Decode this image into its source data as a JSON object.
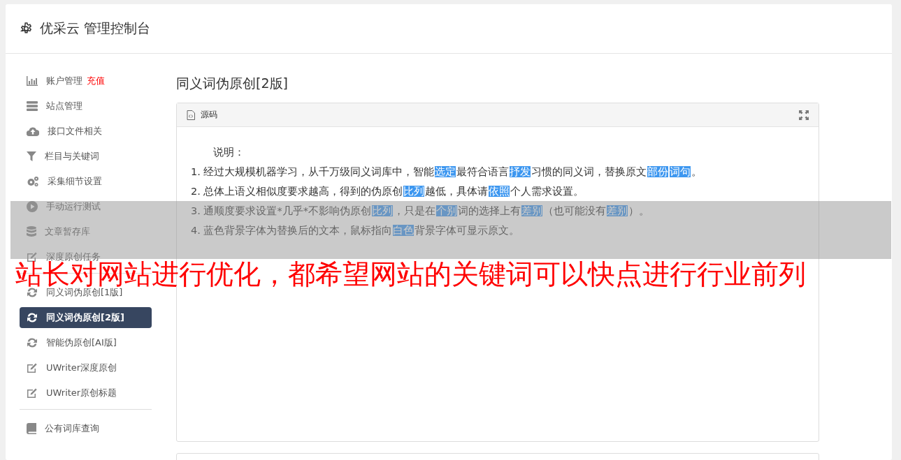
{
  "header": {
    "title": "优采云 管理控制台"
  },
  "sidebar": {
    "groups": [
      [
        {
          "label": "账户管理",
          "badge": "充值",
          "selected": false
        },
        {
          "label": "站点管理",
          "selected": false
        },
        {
          "label": "接口文件相关",
          "selected": false
        },
        {
          "label": "栏目与关键词",
          "selected": false
        },
        {
          "label": "采集细节设置",
          "selected": false
        },
        {
          "label": "手动运行测试",
          "selected": false
        },
        {
          "label": "文章暂存库",
          "selected": false
        },
        {
          "label": "深度原创任务",
          "selected": false
        }
      ],
      [
        {
          "label": "同义词伪原创[1版]",
          "selected": false
        },
        {
          "label": "同义词伪原创[2版]",
          "selected": true
        },
        {
          "label": "智能伪原创[AI版]",
          "selected": false
        },
        {
          "label": "UWriter深度原创",
          "selected": false
        },
        {
          "label": "UWriter原创标题",
          "selected": false
        }
      ],
      [
        {
          "label": "公有词库查询",
          "selected": false
        }
      ]
    ]
  },
  "content": {
    "title": "同义词伪原创[2版]",
    "panel": {
      "title": "源码",
      "intro": "说明：",
      "lines": [
        [
          {
            "text": "1. 经过大规模机器学习，从千万级同义词库中，智能",
            "replaced": false
          },
          {
            "text": "选定",
            "replaced": true
          },
          {
            "text": "最符合语言",
            "replaced": false
          },
          {
            "text": "抒发",
            "replaced": true
          },
          {
            "text": "习惯的同义词，替换原文",
            "replaced": false
          },
          {
            "text": "部份",
            "replaced": true
          },
          {
            "text": "词句",
            "replaced": true
          },
          {
            "text": "。",
            "replaced": false
          }
        ],
        [
          {
            "text": "2. 总体上语义相似度要求越高，得到的伪原创",
            "replaced": false
          },
          {
            "text": "比列",
            "replaced": true
          },
          {
            "text": "越低，具体请",
            "replaced": false
          },
          {
            "text": "依照",
            "replaced": true
          },
          {
            "text": "个人需求设置。",
            "replaced": false
          }
        ],
        [
          {
            "text": "3. 通顺度要求设置*几乎*不影响伪原创",
            "replaced": false
          },
          {
            "text": "比列",
            "replaced": true
          },
          {
            "text": "，只是在",
            "replaced": false
          },
          {
            "text": "个别",
            "replaced": true
          },
          {
            "text": "词的选择上有",
            "replaced": false
          },
          {
            "text": "差别",
            "replaced": true
          },
          {
            "text": "（也可能没有",
            "replaced": false
          },
          {
            "text": "差别",
            "replaced": true
          },
          {
            "text": "）。",
            "replaced": false
          }
        ],
        [
          {
            "text": "4. 蓝色背景字体为替换后的文本，鼠标指向",
            "replaced": false
          },
          {
            "text": "白色",
            "replaced": true
          },
          {
            "text": "背景字体可显示原文。",
            "replaced": false
          }
        ]
      ]
    }
  },
  "overlay_caption": {
    "text": "站长对网站进行优化，都希望网站的关键词可以快点进行行业前列"
  }
}
